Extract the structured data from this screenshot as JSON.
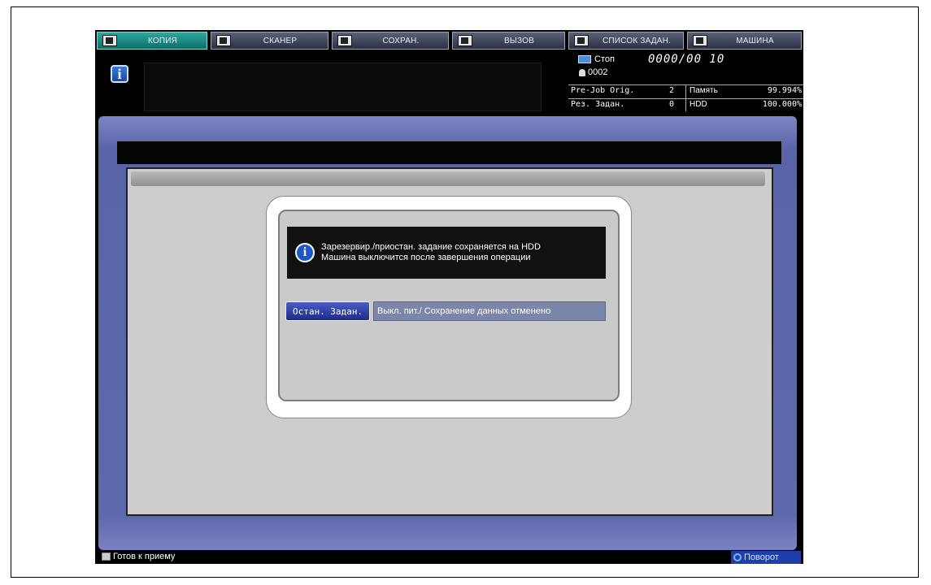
{
  "tabs": [
    {
      "label": "КОПИЯ",
      "icon": "copy-icon",
      "active": true
    },
    {
      "label": "СКАНЕР",
      "icon": "scanner-icon",
      "active": false
    },
    {
      "label": "СОХРАН.",
      "icon": "save-icon",
      "active": false
    },
    {
      "label": "ВЫЗОВ",
      "icon": "recall-icon",
      "active": false
    },
    {
      "label": "СПИСОК ЗАДАН.",
      "icon": "job-list-icon",
      "active": false
    },
    {
      "label": "МАШИНА",
      "icon": "machine-icon",
      "active": false
    }
  ],
  "status": {
    "state": "Стоп",
    "counter": "0000/00 10",
    "user": "0002",
    "prejob_label": "Pre-Job Orig.",
    "prejob_value": "2",
    "memory_label": "Память",
    "memory_value": "99.994%",
    "reserved_label": "Рез. Задан.",
    "reserved_value": "0",
    "hdd_label": "HDD",
    "hdd_value": "100.000%"
  },
  "dialog": {
    "line1": "Зарезервир./приостан. задание сохраняется на HDD",
    "line2": "Машина выключится после завершения операции",
    "stop_button": "Остан. Задан.",
    "stop_note": "Выкл. пит./ Сохранение данных отменено"
  },
  "footer": {
    "ready": "Готов к приему",
    "rotate": "Поворот"
  },
  "colors": {
    "active_tab": "#1a8c86",
    "main_bg": "#5e69ad",
    "button": "#2a3a9c"
  }
}
